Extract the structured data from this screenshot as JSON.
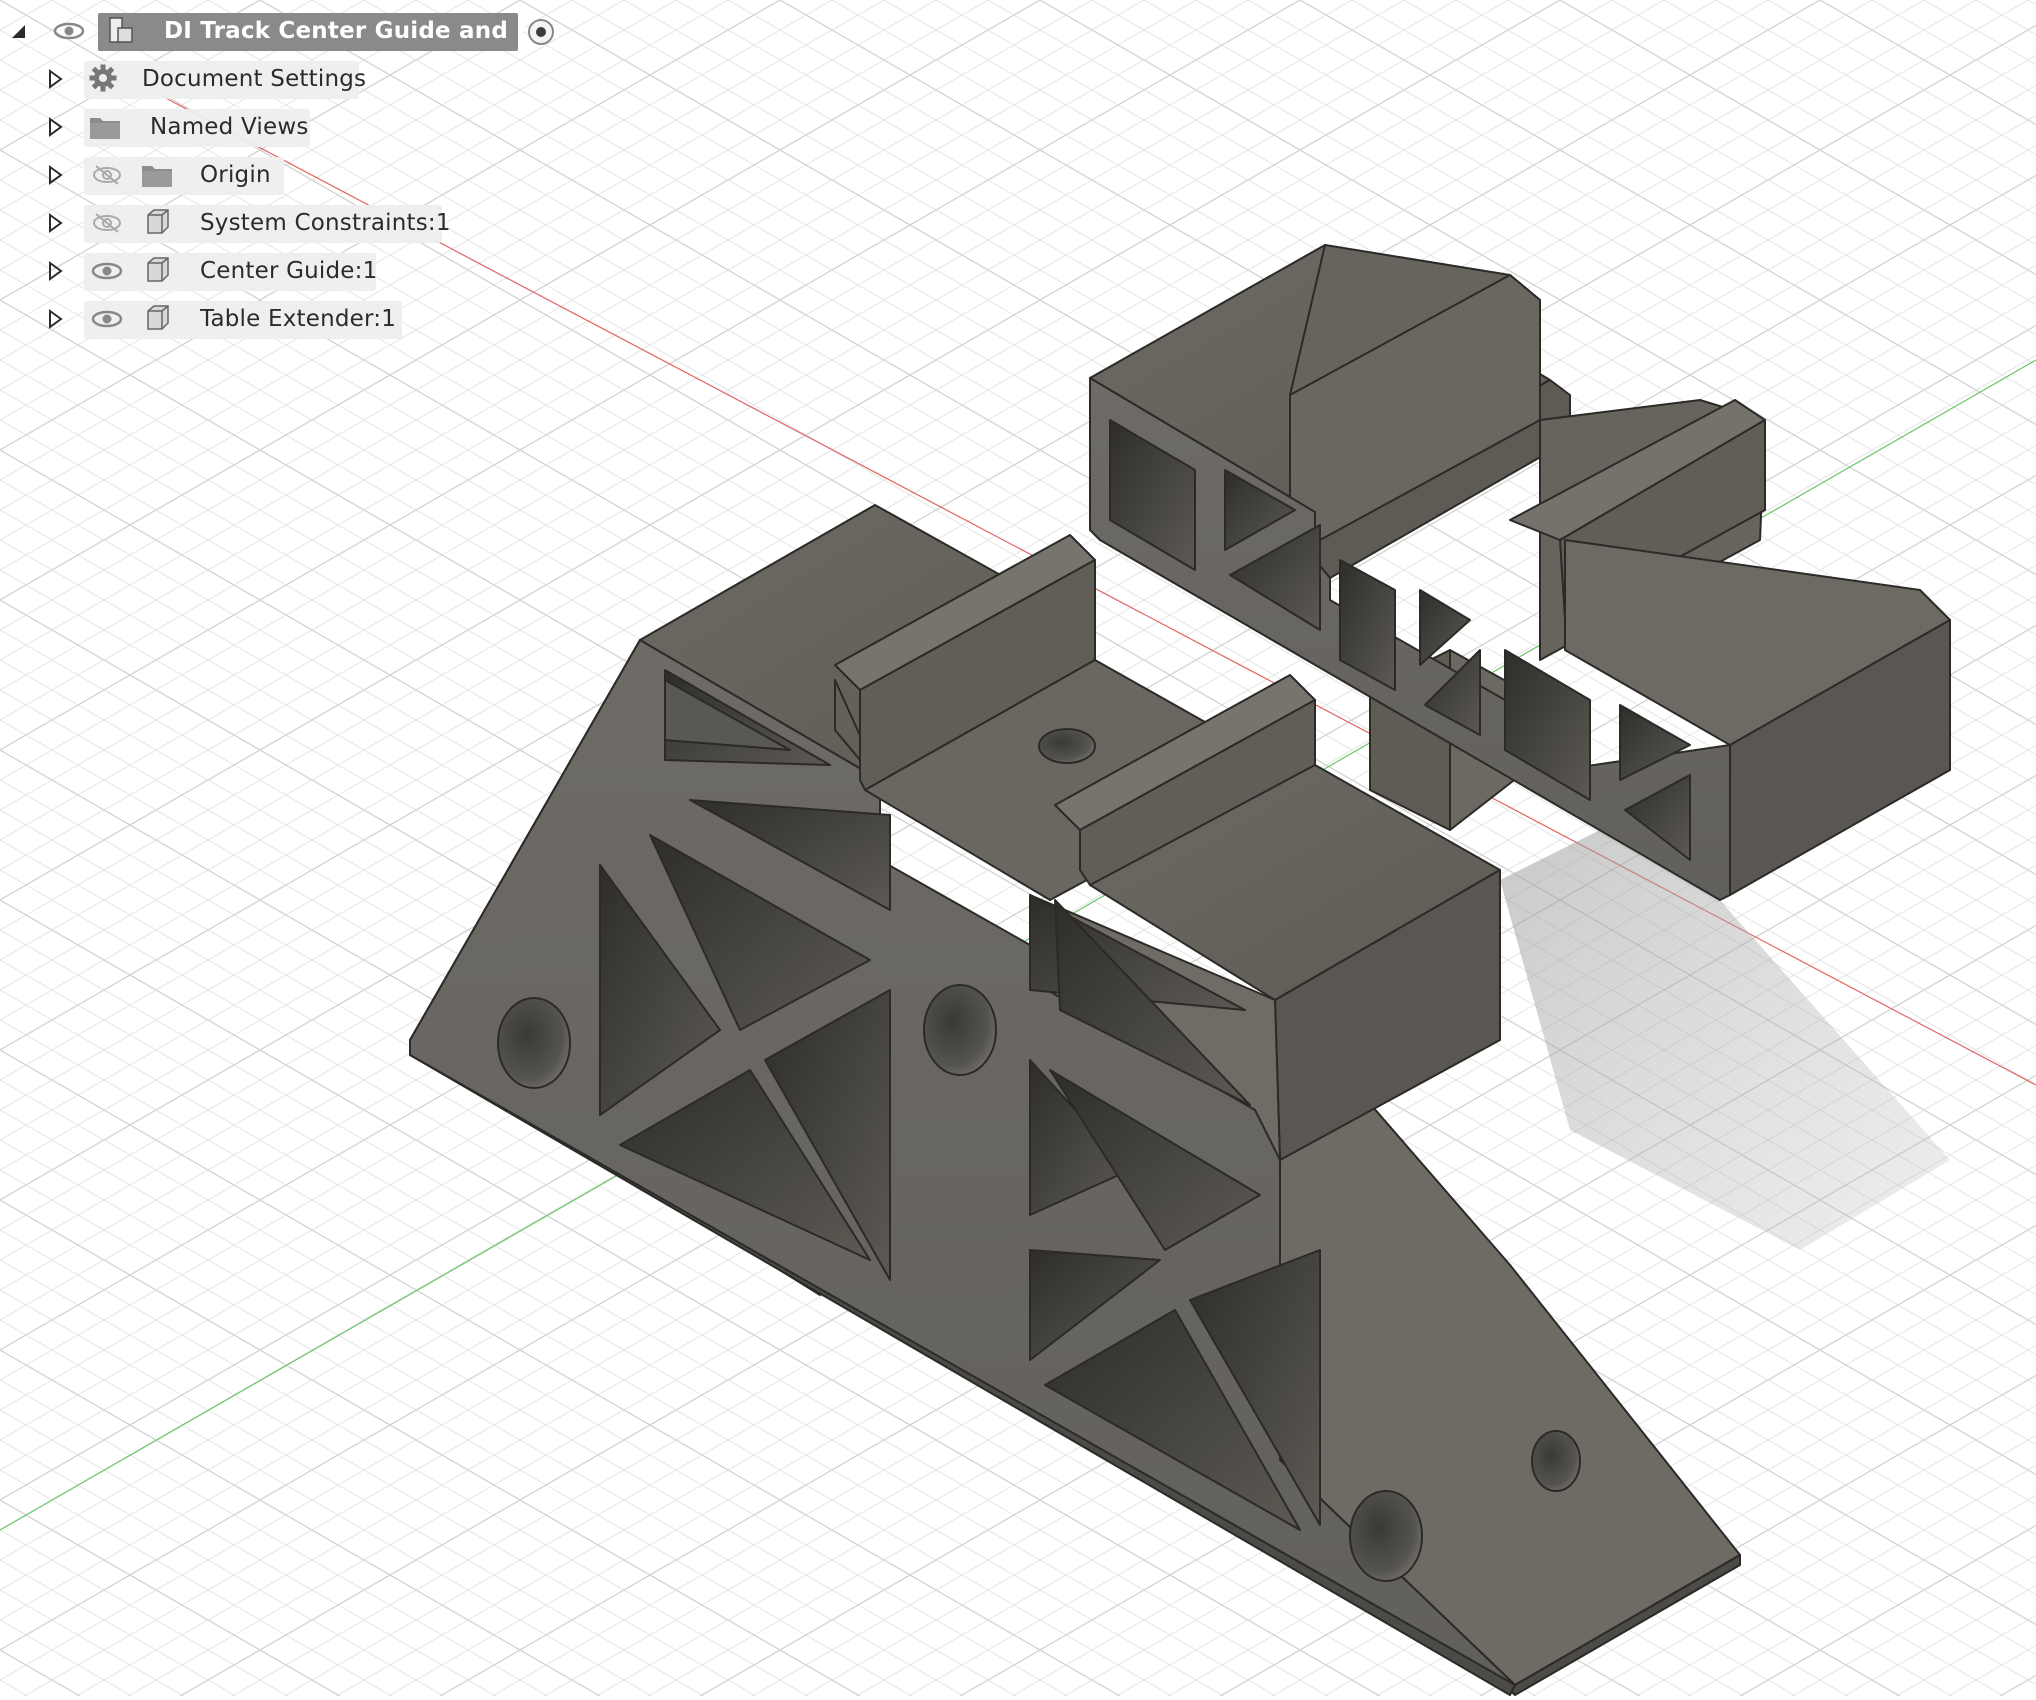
{
  "browser": {
    "root": {
      "label": "DI Track Center Guide and E..."
    },
    "items": [
      {
        "label": "Document Settings",
        "icon": "gear-icon",
        "visibility": "none"
      },
      {
        "label": "Named Views",
        "icon": "folder-icon",
        "visibility": "none"
      },
      {
        "label": "Origin",
        "icon": "folder-icon",
        "visibility": "hidden"
      },
      {
        "label": "System Constraints:1",
        "icon": "component-icon",
        "visibility": "hidden"
      },
      {
        "label": "Center Guide:1",
        "icon": "component-icon",
        "visibility": "visible"
      },
      {
        "label": "Table Extender:1",
        "icon": "component-icon",
        "visibility": "visible"
      }
    ]
  },
  "viewport": {
    "model_color": "#6b6862",
    "grid_color": "#dedede",
    "x_axis_color": "#e06464",
    "y_axis_color": "#6ac46a"
  }
}
